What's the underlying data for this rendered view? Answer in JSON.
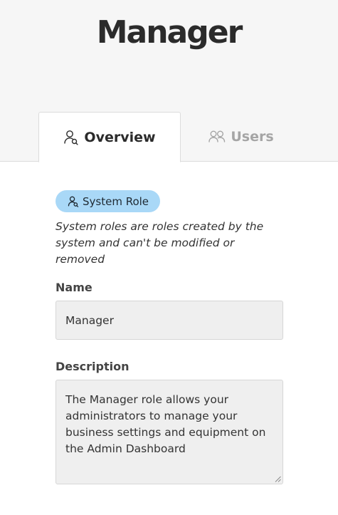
{
  "header": {
    "title": "Manager"
  },
  "tabs": [
    {
      "label": "Overview",
      "icon": "user-icon",
      "active": true
    },
    {
      "label": "Users",
      "icon": "users-icon",
      "active": false
    }
  ],
  "overview": {
    "badge_label": "System Role",
    "badge_icon": "user-icon",
    "badge_color": "#a9d8f7",
    "note": "System roles are roles created by the system and can't be modified or removed",
    "name": {
      "label": "Name",
      "value": "Manager"
    },
    "description": {
      "label": "Description",
      "value": "The Manager role allows your administrators to manage your business settings and equipment on the Admin Dashboard"
    }
  }
}
